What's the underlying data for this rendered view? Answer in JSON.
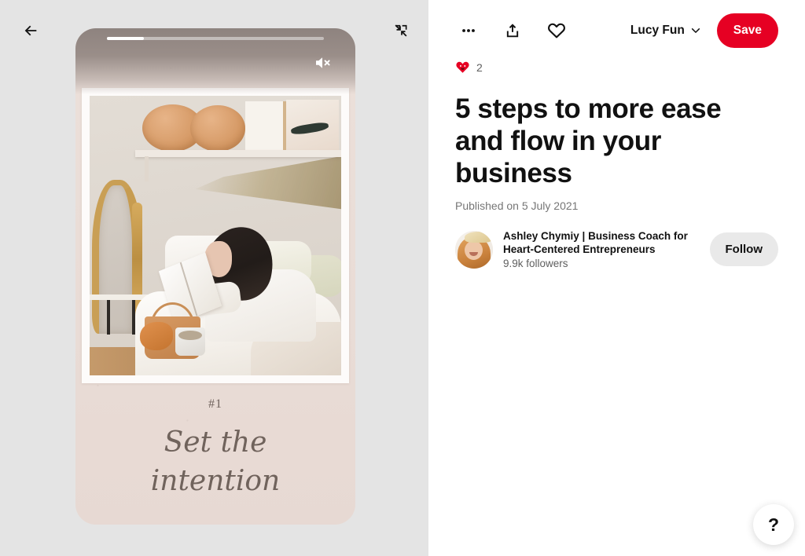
{
  "story": {
    "back_icon": "arrow-left-icon",
    "collapse_icon": "collapse-arrows-icon",
    "mute_icon": "speaker-mute-icon",
    "progress_percent": 17,
    "page_label": "#1",
    "script_line_1": "Set the",
    "script_line_2": "intention",
    "background_color": "#e4e4e4",
    "card_color": "#e8dcd6"
  },
  "toolbar": {
    "more_icon": "ellipsis-icon",
    "share_icon": "share-upload-icon",
    "favorite_icon": "heart-outline-icon",
    "board_name": "Lucy Fun",
    "board_chevron_icon": "chevron-down-icon",
    "save_label": "Save",
    "save_color": "#e60023"
  },
  "reactions": {
    "emoji": "heart-eyes-emoji",
    "count": "2"
  },
  "pin": {
    "title": "5 steps to more ease and flow in your business",
    "published": "Published on 5 July 2021"
  },
  "creator": {
    "avatar_icon": "avatar",
    "name": "Ashley Chymiy | Business Coach for Heart-Centered Entrepreneurs",
    "followers": "9.9k followers",
    "follow_label": "Follow",
    "follow_color": "#e9e9e9"
  },
  "help": {
    "icon": "question-mark-icon",
    "label": "?"
  }
}
